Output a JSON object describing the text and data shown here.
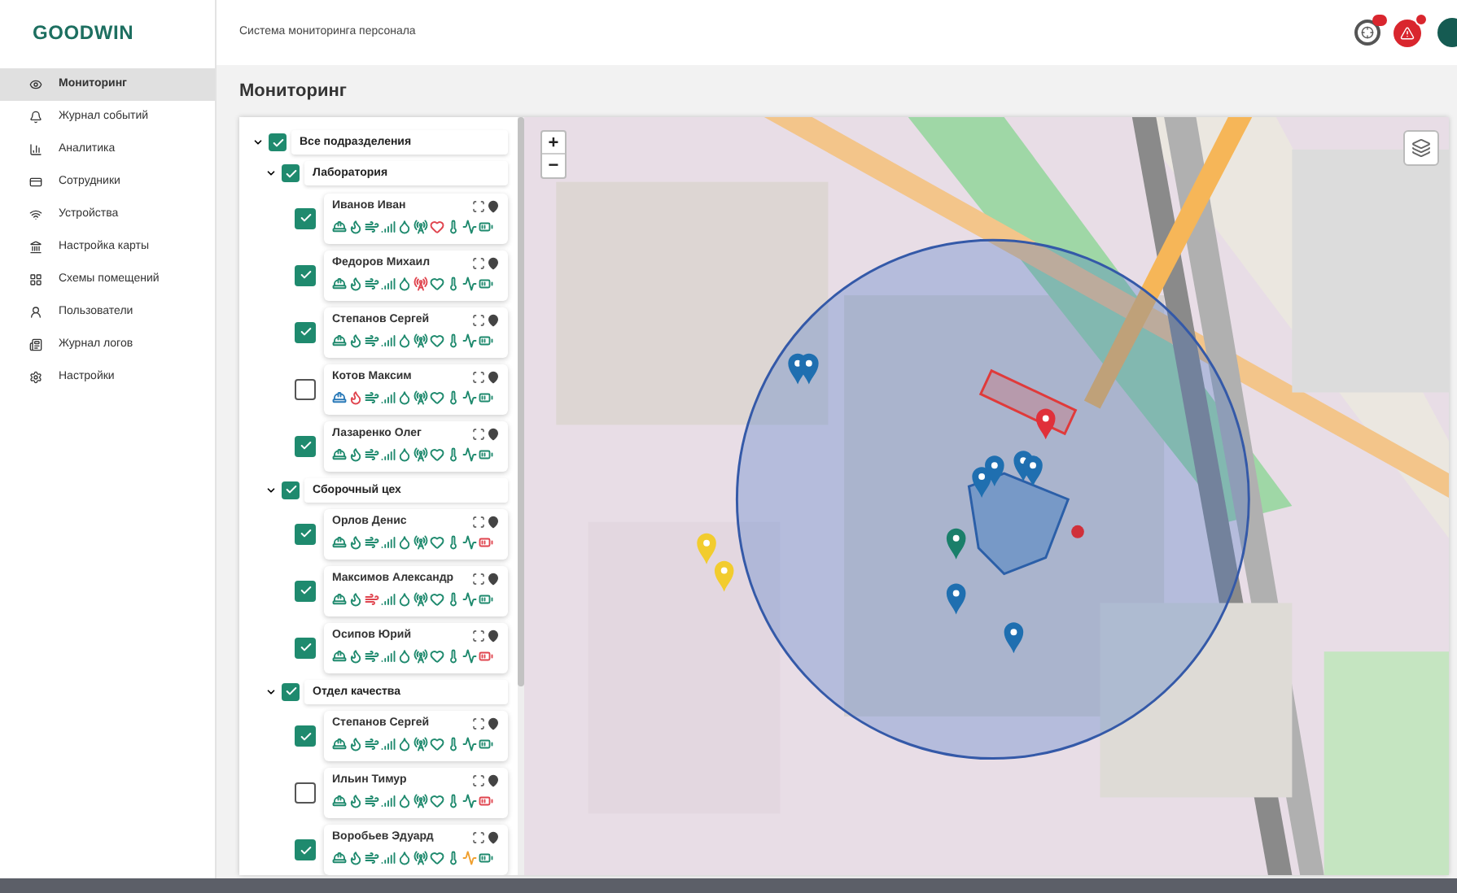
{
  "logo": "GOODWIN",
  "sidebar": {
    "items": [
      {
        "label": "Мониторинг",
        "selected": true
      },
      {
        "label": "Журнал событий",
        "selected": false
      },
      {
        "label": "Аналитика",
        "selected": false
      },
      {
        "label": "Сотрудники",
        "selected": false
      },
      {
        "label": "Устройства",
        "selected": false
      },
      {
        "label": "Настройка карты",
        "selected": false
      },
      {
        "label": "Схемы помещений",
        "selected": false
      },
      {
        "label": "Пользователи",
        "selected": false
      },
      {
        "label": "Журнал логов",
        "selected": false
      },
      {
        "label": "Настройки",
        "selected": false
      }
    ]
  },
  "header": {
    "title": "Система мониторинга персонала"
  },
  "page_title": "Мониторинг",
  "tree": {
    "label": "Все подразделения",
    "checked": true,
    "expanded": true,
    "children": [
      {
        "label": "Лаборатория",
        "checked": true,
        "expanded": true,
        "workers": [
          {
            "name": "Иванов Иван",
            "checked": true,
            "sensors": [
              {
                "color": "#1f8a6e"
              },
              {
                "color": "#1f8a6e"
              },
              {
                "color": "#1f8a6e"
              },
              {
                "color": "#1f8a6e"
              },
              {
                "color": "#1f8a6e"
              },
              {
                "color": "#1f8a6e"
              },
              {
                "color": "#e0454f"
              },
              {
                "color": "#1f8a6e"
              },
              {
                "color": "#1f8a6e"
              },
              {
                "color": "#1f8a6e"
              }
            ]
          },
          {
            "name": "Федоров Михаил",
            "checked": true,
            "sensors": [
              {
                "color": "#1f8a6e"
              },
              {
                "color": "#1f8a6e"
              },
              {
                "color": "#1f8a6e"
              },
              {
                "color": "#1f8a6e"
              },
              {
                "color": "#1f8a6e"
              },
              {
                "color": "#e0454f"
              },
              {
                "color": "#1f8a6e"
              },
              {
                "color": "#1f8a6e"
              },
              {
                "color": "#1f8a6e"
              },
              {
                "color": "#1f8a6e"
              }
            ]
          },
          {
            "name": "Степанов Сергей",
            "checked": true,
            "sensors": [
              {
                "color": "#1f8a6e"
              },
              {
                "color": "#1f8a6e"
              },
              {
                "color": "#1f8a6e"
              },
              {
                "color": "#1f8a6e"
              },
              {
                "color": "#1f8a6e"
              },
              {
                "color": "#1f8a6e"
              },
              {
                "color": "#1f8a6e"
              },
              {
                "color": "#1f8a6e"
              },
              {
                "color": "#1f8a6e"
              },
              {
                "color": "#1f8a6e"
              }
            ]
          },
          {
            "name": "Котов Максим",
            "checked": false,
            "sensors": [
              {
                "color": "#2a7ab8"
              },
              {
                "color": "#e0454f"
              },
              {
                "color": "#1f8a6e"
              },
              {
                "color": "#1f8a6e"
              },
              {
                "color": "#1f8a6e"
              },
              {
                "color": "#1f8a6e"
              },
              {
                "color": "#1f8a6e"
              },
              {
                "color": "#1f8a6e"
              },
              {
                "color": "#1f8a6e"
              },
              {
                "color": "#1f8a6e"
              }
            ]
          },
          {
            "name": "Лазаренко Олег",
            "checked": true,
            "sensors": [
              {
                "color": "#1f8a6e"
              },
              {
                "color": "#1f8a6e"
              },
              {
                "color": "#1f8a6e"
              },
              {
                "color": "#1f8a6e"
              },
              {
                "color": "#1f8a6e"
              },
              {
                "color": "#1f8a6e"
              },
              {
                "color": "#1f8a6e"
              },
              {
                "color": "#1f8a6e"
              },
              {
                "color": "#1f8a6e"
              },
              {
                "color": "#1f8a6e"
              }
            ]
          }
        ]
      },
      {
        "label": "Сборочный цех",
        "checked": true,
        "expanded": true,
        "workers": [
          {
            "name": "Орлов Денис",
            "checked": true,
            "sensors": [
              {
                "color": "#1f8a6e"
              },
              {
                "color": "#1f8a6e"
              },
              {
                "color": "#1f8a6e"
              },
              {
                "color": "#1f8a6e"
              },
              {
                "color": "#1f8a6e"
              },
              {
                "color": "#1f8a6e"
              },
              {
                "color": "#1f8a6e"
              },
              {
                "color": "#1f8a6e"
              },
              {
                "color": "#1f8a6e"
              },
              {
                "color": "#e0454f"
              }
            ]
          },
          {
            "name": "Максимов Александр",
            "checked": true,
            "sensors": [
              {
                "color": "#1f8a6e"
              },
              {
                "color": "#1f8a6e"
              },
              {
                "color": "#e0454f"
              },
              {
                "color": "#1f8a6e"
              },
              {
                "color": "#1f8a6e"
              },
              {
                "color": "#1f8a6e"
              },
              {
                "color": "#1f8a6e"
              },
              {
                "color": "#1f8a6e"
              },
              {
                "color": "#1f8a6e"
              },
              {
                "color": "#1f8a6e"
              }
            ]
          },
          {
            "name": "Осипов Юрий",
            "checked": true,
            "sensors": [
              {
                "color": "#1f8a6e"
              },
              {
                "color": "#1f8a6e"
              },
              {
                "color": "#1f8a6e"
              },
              {
                "color": "#1f8a6e"
              },
              {
                "color": "#1f8a6e"
              },
              {
                "color": "#1f8a6e"
              },
              {
                "color": "#1f8a6e"
              },
              {
                "color": "#1f8a6e"
              },
              {
                "color": "#1f8a6e"
              },
              {
                "color": "#e0454f"
              }
            ]
          }
        ]
      },
      {
        "label": "Отдел качества",
        "checked": true,
        "expanded": true,
        "workers": [
          {
            "name": "Степанов Сергей",
            "checked": true,
            "sensors": [
              {
                "color": "#1f8a6e"
              },
              {
                "color": "#1f8a6e"
              },
              {
                "color": "#1f8a6e"
              },
              {
                "color": "#1f8a6e"
              },
              {
                "color": "#1f8a6e"
              },
              {
                "color": "#1f8a6e"
              },
              {
                "color": "#1f8a6e"
              },
              {
                "color": "#1f8a6e"
              },
              {
                "color": "#1f8a6e"
              },
              {
                "color": "#1f8a6e"
              }
            ]
          },
          {
            "name": "Ильин Тимур",
            "checked": false,
            "sensors": [
              {
                "color": "#1f8a6e"
              },
              {
                "color": "#1f8a6e"
              },
              {
                "color": "#1f8a6e"
              },
              {
                "color": "#1f8a6e"
              },
              {
                "color": "#1f8a6e"
              },
              {
                "color": "#1f8a6e"
              },
              {
                "color": "#1f8a6e"
              },
              {
                "color": "#1f8a6e"
              },
              {
                "color": "#1f8a6e"
              },
              {
                "color": "#e0454f"
              }
            ]
          },
          {
            "name": "Воробьев Эдуард",
            "checked": true,
            "sensors": [
              {
                "color": "#1f8a6e"
              },
              {
                "color": "#1f8a6e"
              },
              {
                "color": "#1f8a6e"
              },
              {
                "color": "#1f8a6e"
              },
              {
                "color": "#1f8a6e"
              },
              {
                "color": "#1f8a6e"
              },
              {
                "color": "#1f8a6e"
              },
              {
                "color": "#1f8a6e"
              },
              {
                "color": "#f0a030"
              },
              {
                "color": "#1f8a6e"
              }
            ]
          }
        ]
      }
    ]
  },
  "map": {
    "zoom_in": "+",
    "zoom_out": "−",
    "markers": [
      {
        "kind": "pin",
        "color": "#1f6fb0"
      },
      {
        "kind": "pin",
        "color": "#1f6fb0"
      },
      {
        "kind": "pin",
        "color": "#e0303a"
      },
      {
        "kind": "pin",
        "color": "#1f6fb0"
      },
      {
        "kind": "pin",
        "color": "#1f6fb0"
      },
      {
        "kind": "pin",
        "color": "#1f6fb0"
      },
      {
        "kind": "pin",
        "color": "#1f6fb0"
      },
      {
        "kind": "pin",
        "color": "#1a7f6a"
      },
      {
        "kind": "pin",
        "color": "#1f6fb0"
      },
      {
        "kind": "pin",
        "color": "#1f6fb0"
      },
      {
        "kind": "pin",
        "color": "#f2cc2e"
      },
      {
        "kind": "pin",
        "color": "#f2cc2e"
      },
      {
        "kind": "dot",
        "color": "#d0303a"
      }
    ]
  }
}
